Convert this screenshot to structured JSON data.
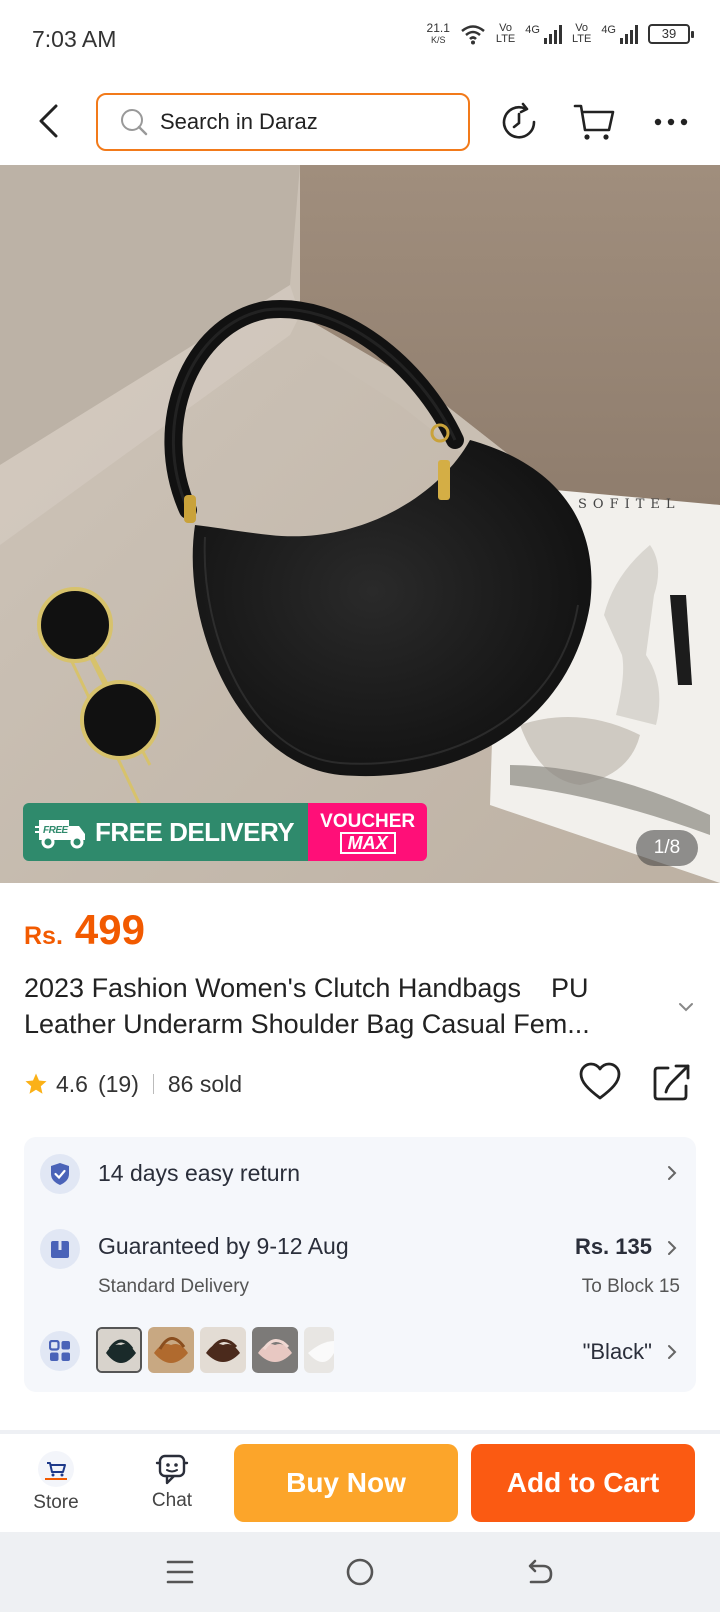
{
  "status_bar": {
    "time": "7:03 AM",
    "speed_value": "21.1",
    "speed_unit": "K/S",
    "sim1_label_top": "Vo",
    "sim1_label_bottom": "LTE",
    "sim1_net": "4G",
    "sim2_label_top": "Vo",
    "sim2_label_bottom": "LTE",
    "sim2_net": "4G",
    "battery": "39"
  },
  "header": {
    "search_placeholder": "Search in Daraz",
    "icons": [
      "back-arrow-icon",
      "search-icon",
      "history-icon",
      "cart-icon",
      "more-icon"
    ]
  },
  "gallery": {
    "counter": "1/8",
    "badge_free_label": "FREE DELIVERY",
    "badge_free_truck_text": "FREE",
    "badge_voucher_top": "VOUCHER",
    "badge_voucher_bottom": "MAX"
  },
  "product": {
    "currency": "Rs.",
    "price": "499",
    "title": "2023 Fashion Women's Clutch Handbags    PU Leather Underarm Shoulder Bag Casual Fem...",
    "rating": "4.6",
    "reviews": "(19)",
    "sold": "86 sold"
  },
  "info": {
    "return_label": "14 days easy return",
    "delivery_label": "Guaranteed by 9-12 Aug",
    "delivery_type": "Standard Delivery",
    "delivery_fee": "Rs. 135",
    "delivery_dest": "To Block 15",
    "variant_selected": "\"Black\""
  },
  "bottom_bar": {
    "store_label": "Store",
    "chat_label": "Chat",
    "buy_now_label": "Buy Now",
    "add_to_cart_label": "Add to Cart"
  },
  "colors": {
    "accent_orange": "#f25a00",
    "buy_now": "#fca52a",
    "add_to_cart": "#fb5a12",
    "free_delivery": "#2f8a6c",
    "voucher": "#ff0f78"
  }
}
